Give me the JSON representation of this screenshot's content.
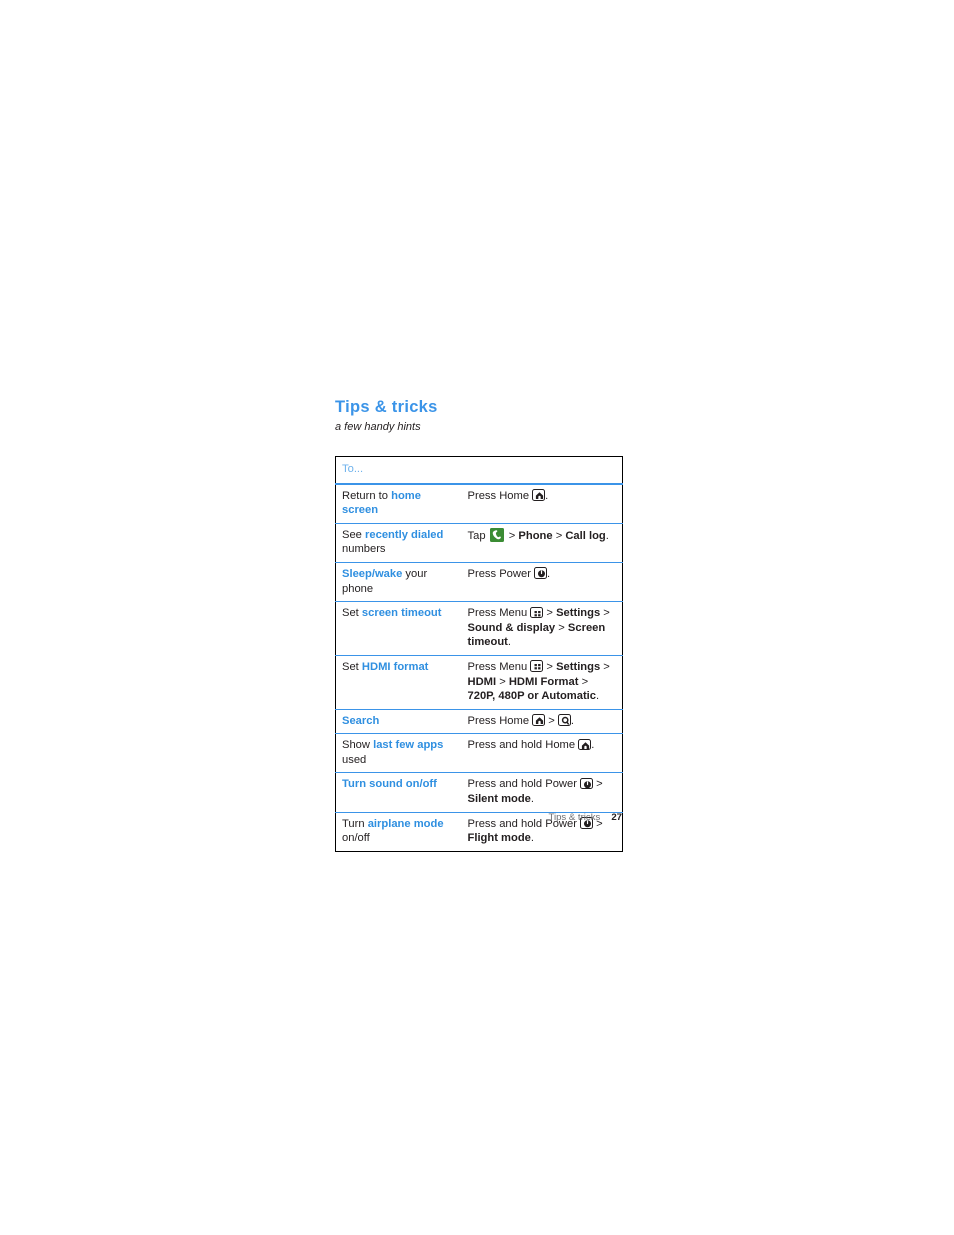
{
  "page": {
    "title": "Tips & tricks",
    "subtitle": "a few handy hints"
  },
  "colors": {
    "accent_blue": "#3b94e8",
    "link_blue": "#2f8fe0",
    "header_blue": "#6fb2ec",
    "phone_icon_green": "#3b8c34",
    "text": "#231f20",
    "footer_gray": "#6d6e71"
  },
  "table": {
    "header": {
      "col1": "To...",
      "col2": ""
    },
    "rows": [
      {
        "to": {
          "pre": "Return to ",
          "link": "home screen",
          "post": ""
        },
        "action": {
          "pre": "Press Home ",
          "icon": "home-key-icon",
          "post": "."
        }
      },
      {
        "to": {
          "pre": "See ",
          "link": "recently dialed",
          "post": " numbers"
        },
        "action": {
          "pre": "Tap ",
          "icon": "phone-app-icon",
          "bold1": "Phone",
          "gt1": " > ",
          "bold2": "Call log",
          "post": "."
        }
      },
      {
        "to": {
          "pre": "",
          "link": "Sleep/wake",
          "post": " your phone"
        },
        "action": {
          "pre": "Press Power ",
          "icon": "power-key-icon",
          "post": "."
        }
      },
      {
        "to": {
          "pre": "Set ",
          "link": "screen timeout",
          "post": ""
        },
        "action": {
          "pre": "Press Menu ",
          "icon": "menu-key-icon",
          "gt1": " > ",
          "bold1": "Settings",
          "gt2": " > ",
          "bold2": "Sound & display",
          "gt3": " > ",
          "bold3": "Screen timeout",
          "post": "."
        }
      },
      {
        "to": {
          "pre": "Set ",
          "link": "HDMI format",
          "post": ""
        },
        "action": {
          "pre": "Press Menu ",
          "icon": "menu-key-icon",
          "gt1": " > ",
          "bold1": "Settings",
          "gt2": " > ",
          "bold2": "HDMI",
          "gt3": " > ",
          "bold3": "HDMI Format",
          "gt4": " > ",
          "bold4": "720P, 480P or Automatic",
          "post": "."
        }
      },
      {
        "to": {
          "pre": "",
          "link": "Search",
          "post": ""
        },
        "action": {
          "pre": "Press Home ",
          "icon": "home-key-icon",
          "gt1": " > ",
          "icon2": "search-key-icon",
          "post": "."
        }
      },
      {
        "to": {
          "pre": "Show ",
          "link": "last few apps",
          "post": " used"
        },
        "action": {
          "pre": "Press and hold Home ",
          "icon": "home-key-icon",
          "post": "."
        }
      },
      {
        "to": {
          "pre": "",
          "link": "Turn sound on/off",
          "post": ""
        },
        "action": {
          "pre": "Press and hold Power ",
          "icon": "power-key-icon",
          "gt1": " > ",
          "bold1": "Silent mode",
          "post": "."
        }
      },
      {
        "to": {
          "pre": "Turn ",
          "link": "airplane mode",
          "post": " on/off"
        },
        "action": {
          "pre": "Press and hold Power ",
          "icon": "power-key-icon",
          "gt1": " > ",
          "bold1": "Flight mode",
          "post": "."
        }
      }
    ]
  },
  "footer": {
    "section": "Tips & tricks",
    "page_number": "27"
  }
}
